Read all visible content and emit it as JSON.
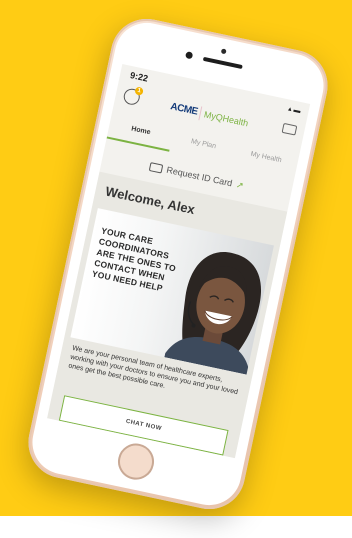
{
  "status": {
    "time": "9:22",
    "icons": "▴ ▬"
  },
  "header": {
    "badge_count": "1",
    "brand_name": "ACME",
    "brand_subtitle": "MyQHealth"
  },
  "tabs": [
    {
      "label": "Home",
      "active": true
    },
    {
      "label": "My Plan",
      "active": false
    },
    {
      "label": "My Health",
      "active": false
    }
  ],
  "request_card": {
    "label": "Request ID Card"
  },
  "main": {
    "welcome": "Welcome, Alex",
    "hero_text": "YOUR CARE COORDINATORS ARE THE ONES TO CONTACT WHEN YOU NEED HELP",
    "body_text": "We are your personal team of healthcare experts, working with your doctors to ensure you and your loved ones get the best possible care.",
    "chat_label": "CHAT NOW"
  },
  "colors": {
    "background": "#ffcc14",
    "accent": "#7cb342",
    "brand": "#153c7a"
  },
  "icons": [
    "avatar-icon",
    "card-icon",
    "id-card-icon",
    "arrow-icon",
    "home-button"
  ]
}
